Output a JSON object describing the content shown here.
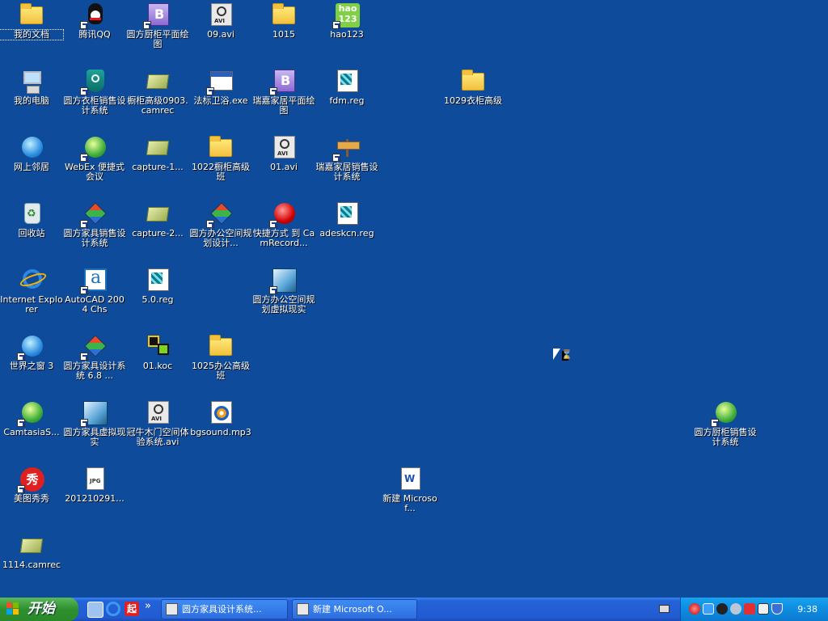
{
  "desktop": {
    "icons": [
      {
        "label": "我的文档",
        "icon": "my-documents-icon",
        "selected": true
      },
      {
        "label": "腾讯QQ",
        "icon": "qq-icon",
        "shortcut": true
      },
      {
        "label": "圆方厨柜平面绘图",
        "icon": "kitchen-plan-icon",
        "shortcut": true
      },
      {
        "label": "09.avi",
        "icon": "avi-file-icon"
      },
      {
        "label": "1015",
        "icon": "folder-icon"
      },
      {
        "label": "hao123",
        "icon": "hao123-icon",
        "shortcut": true
      },
      {
        "label": "我的电脑",
        "icon": "my-computer-icon"
      },
      {
        "label": "圆方衣柜销售设计系统",
        "icon": "wardrobe-sales-icon",
        "shortcut": true
      },
      {
        "label": "橱柜高级0903.camrec",
        "icon": "camrec-file-icon"
      },
      {
        "label": "法标卫浴.exe",
        "icon": "exe-file-icon",
        "shortcut": true
      },
      {
        "label": "瑞嘉家居平面绘图",
        "icon": "ruijia-plan-icon",
        "shortcut": true
      },
      {
        "label": "fdm.reg",
        "icon": "reg-file-icon"
      },
      {
        "label": "1029衣柜高级",
        "icon": "folder-icon"
      },
      {
        "label": "网上邻居",
        "icon": "network-places-icon"
      },
      {
        "label": "WebEx 便捷式会议",
        "icon": "webex-icon",
        "shortcut": true
      },
      {
        "label": "capture-1...",
        "icon": "camrec-file-icon"
      },
      {
        "label": "1022橱柜高级班",
        "icon": "folder-icon"
      },
      {
        "label": "01.avi",
        "icon": "avi-file-icon"
      },
      {
        "label": "瑞嘉家居销售设计系统",
        "icon": "signpost-icon",
        "shortcut": true
      },
      {
        "label": "回收站",
        "icon": "recycle-bin-icon"
      },
      {
        "label": "圆方家具销售设计系统",
        "icon": "furniture-sales-icon",
        "shortcut": true
      },
      {
        "label": "capture-2...",
        "icon": "camrec-file-icon"
      },
      {
        "label": "圆方办公空间规划设计...",
        "icon": "office-planning-icon",
        "shortcut": true
      },
      {
        "label": "快捷方式 到 CamRecord...",
        "icon": "camrecorder-icon",
        "shortcut": true
      },
      {
        "label": "adeskcn.reg",
        "icon": "reg-file-icon"
      },
      {
        "label": "Internet Explorer",
        "icon": "internet-explorer-icon"
      },
      {
        "label": "AutoCAD 2004 Chs",
        "icon": "autocad-icon",
        "shortcut": true
      },
      {
        "label": "5.0.reg",
        "icon": "reg-file-icon"
      },
      {
        "label": "圆方办公空间规划虚拟现实",
        "icon": "office-vr-icon",
        "shortcut": true
      },
      {
        "label": "世界之窗 3",
        "icon": "theworld-browser-icon",
        "shortcut": true
      },
      {
        "label": "圆方家具设计系统 6.8 ...",
        "icon": "furniture-design-icon",
        "shortcut": true
      },
      {
        "label": "01.koc",
        "icon": "koc-file-icon"
      },
      {
        "label": "1025办公高级班",
        "icon": "folder-icon"
      },
      {
        "label": "CamtasiaS...",
        "icon": "camtasia-icon",
        "shortcut": true
      },
      {
        "label": "圆方家具虚拟现实",
        "icon": "furniture-vr-icon",
        "shortcut": true
      },
      {
        "label": "冠牛木门空间体验系统.avi",
        "icon": "avi-file-icon"
      },
      {
        "label": "bgsound.mp3",
        "icon": "mp3-file-icon"
      },
      {
        "label": "圆方厨柜销售设计系统",
        "icon": "kitchen-sales-icon",
        "shortcut": true
      },
      {
        "label": "美图秀秀",
        "icon": "meitu-icon",
        "shortcut": true
      },
      {
        "label": "201210291...",
        "icon": "jpg-file-icon"
      },
      {
        "label": "新建 Microsof...",
        "icon": "word-document-icon"
      },
      {
        "label": "1114.camrec",
        "icon": "camrec-file-icon"
      }
    ]
  },
  "taskbar": {
    "start_label": "开始",
    "quick_launch": [
      "show-desktop-icon",
      "internet-explorer-icon",
      "search-engine-icon"
    ],
    "quick_launch_badge": "起",
    "overflow_label": "»",
    "tasks": [
      {
        "label": "圆方家具设计系统...",
        "icon": "furniture-design-icon"
      },
      {
        "label": "新建 Microsoft O...",
        "icon": "word-document-icon"
      }
    ],
    "tray_icons": [
      "camrecorder-icon",
      "network-icon",
      "qq-tray-icon",
      "speaker-icon",
      "security-icon",
      "antivirus-icon",
      "shield-icon"
    ],
    "clock": "9:38"
  },
  "colors": {
    "desktop_bg": "#0f4b9b",
    "taskbar_blue": "#225bd1",
    "start_green": "#2e8f2e",
    "tray_blue": "#0e8ce0"
  }
}
